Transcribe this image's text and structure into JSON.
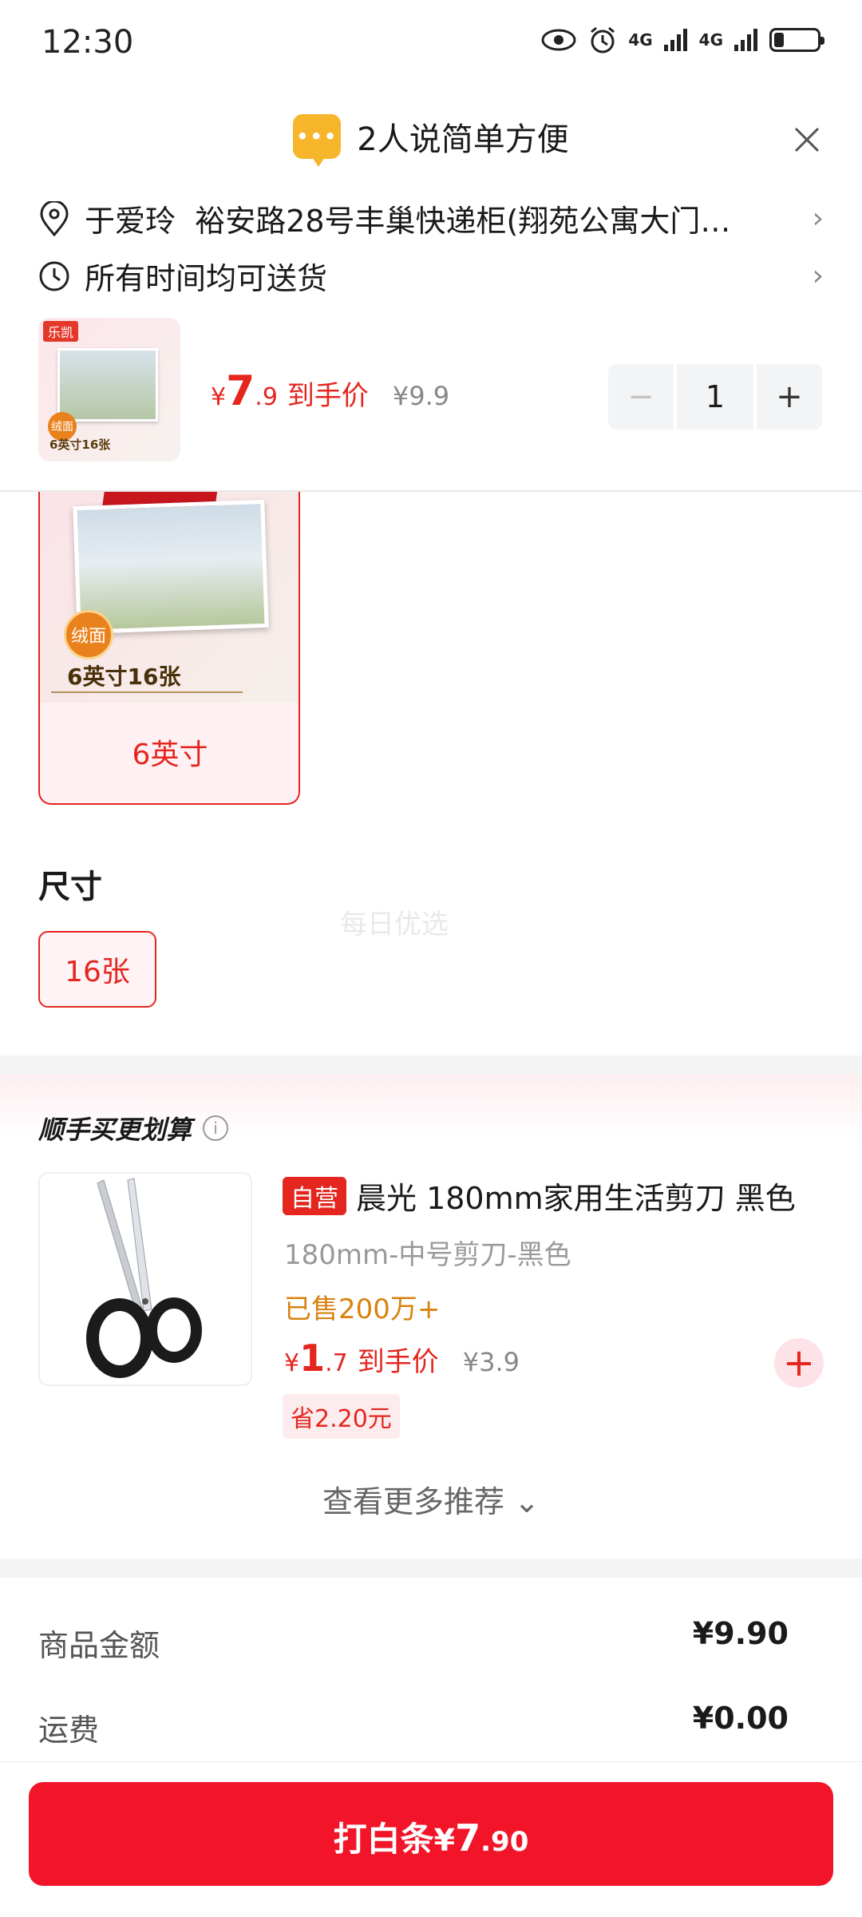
{
  "status_bar": {
    "time": "12:30",
    "net1": "4G",
    "net2": "4G"
  },
  "notice": {
    "badge": "•••",
    "text": "2人说简单方便"
  },
  "address": {
    "name": "于爱玲",
    "detail": "裕安路28号丰巢快递柜(翔苑公寓大门…"
  },
  "delivery": {
    "text": "所有时间均可送货"
  },
  "summary": {
    "logo": "乐凯",
    "thumb_badge": "绒面",
    "thumb_caption": "6英寸16张",
    "currency": "¥",
    "price_int": "7",
    "price_dec": ".9",
    "price_label": "到手价",
    "original_price": "¥9.9",
    "quantity": "1",
    "minus": "−",
    "plus": "+"
  },
  "variant": {
    "badge": "绒面",
    "caption": "6英寸16张",
    "label": "6英寸"
  },
  "size_section": {
    "title": "尺寸",
    "option": "16张",
    "watermark": "每日优选"
  },
  "recommend": {
    "title": "顺手买更划算",
    "info": "i",
    "item": {
      "tag": "自营",
      "title": "晨光 180mm家用生活剪刀 黑色",
      "spec": "180mm-中号剪刀-黑色",
      "sold": "已售200万+",
      "currency": "¥",
      "price_int": "1",
      "price_dec": ".7",
      "price_label": "到手价",
      "original_price": "¥3.9",
      "save": "省2.20元",
      "add": "+"
    },
    "more": "查看更多推荐 ⌄"
  },
  "totals": [
    {
      "label": "商品金额",
      "value": "¥9.90"
    },
    {
      "label": "运费",
      "value": "¥0.00"
    }
  ],
  "pay_button": {
    "label": "打白条 ",
    "currency": "¥",
    "int": "7",
    "dec": ".90"
  },
  "colors": {
    "accent": "#e4261f",
    "pay": "#f21529",
    "sold": "#d9820f"
  }
}
